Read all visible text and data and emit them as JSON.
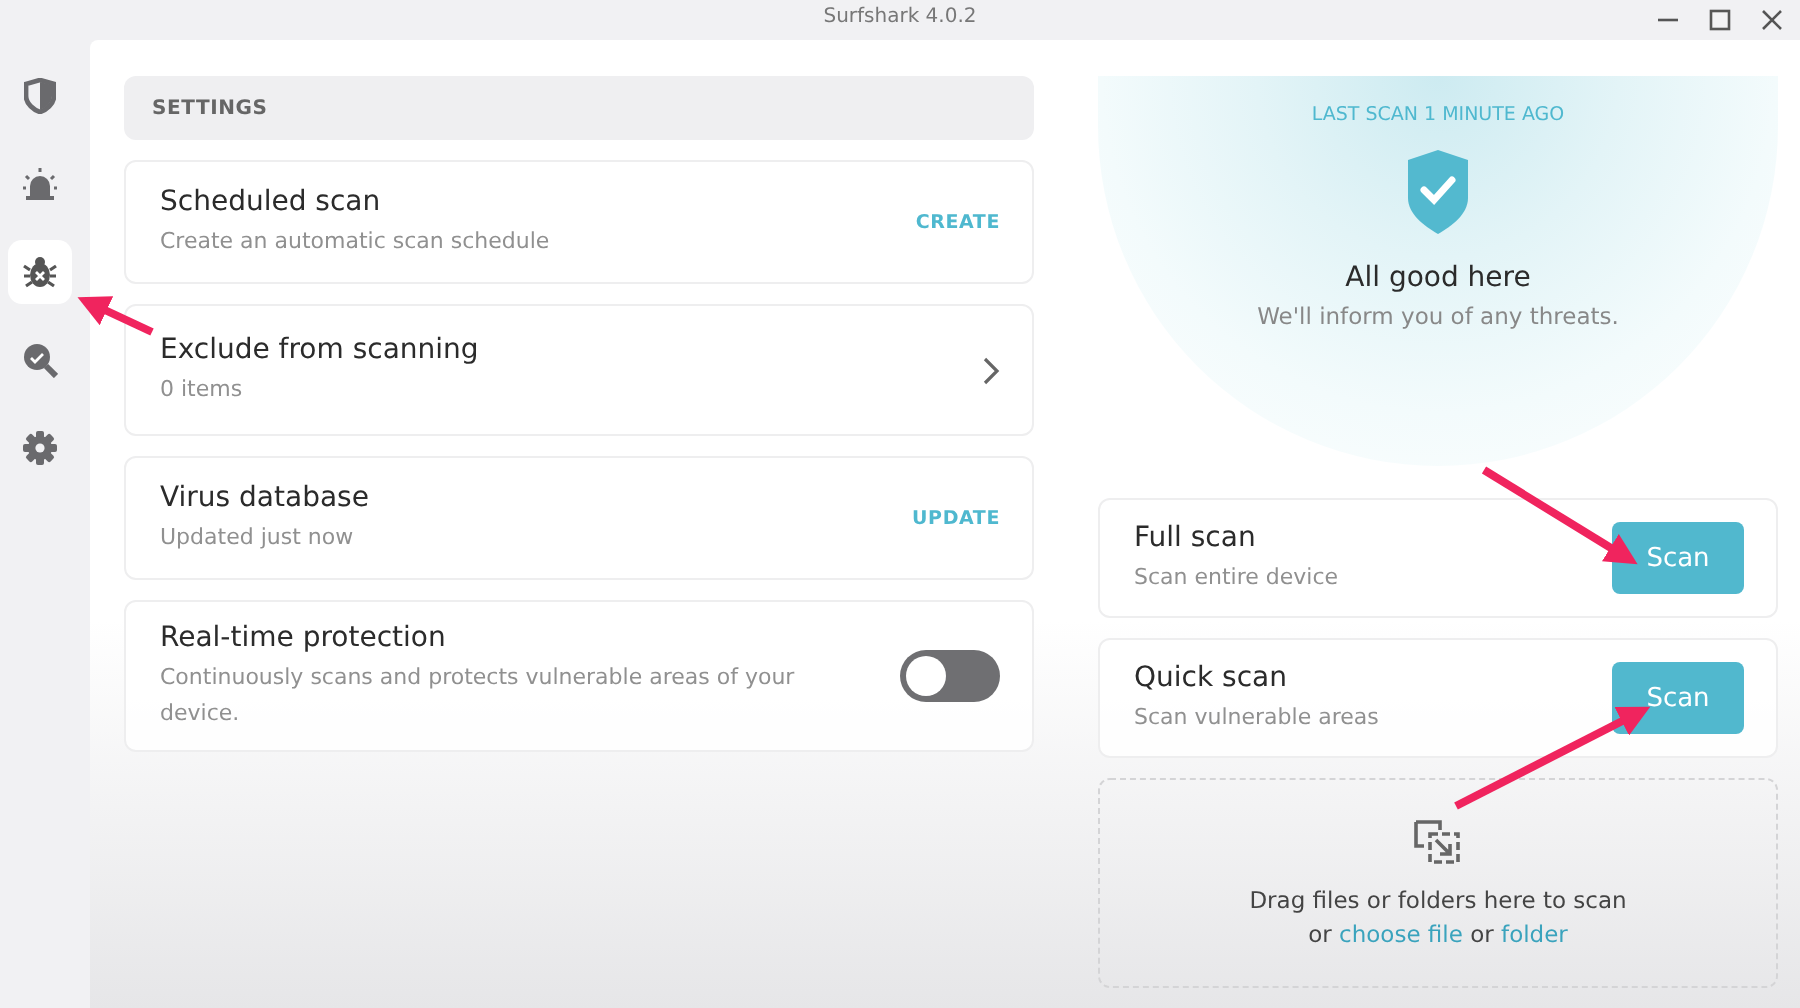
{
  "window": {
    "title": "Surfshark 4.0.2"
  },
  "sidebar": {
    "items": [
      {
        "kind": "shield",
        "selected": false
      },
      {
        "kind": "alarm",
        "selected": false
      },
      {
        "kind": "bug",
        "selected": true
      },
      {
        "kind": "search",
        "selected": false
      },
      {
        "kind": "gear",
        "selected": false
      }
    ]
  },
  "settings": {
    "header": "SETTINGS",
    "rows": [
      {
        "kind": "action",
        "title": "Scheduled scan",
        "subtitle": "Create an automatic scan schedule",
        "action": "CREATE"
      },
      {
        "kind": "chevron",
        "title": "Exclude from scanning",
        "subtitle": "0 items"
      },
      {
        "kind": "action",
        "title": "Virus database",
        "subtitle": "Updated just now",
        "action": "UPDATE"
      },
      {
        "kind": "toggle",
        "title": "Real-time protection",
        "subtitle": "Continuously scans and protects vulnerable areas of your device.",
        "on": false
      }
    ]
  },
  "status": {
    "last_scan": "LAST SCAN 1 MINUTE AGO",
    "title": "All good here",
    "subtitle": "We'll inform you of any threats."
  },
  "scans": [
    {
      "title": "Full scan",
      "subtitle": "Scan entire device",
      "button": "Scan"
    },
    {
      "title": "Quick scan",
      "subtitle": "Scan vulnerable areas",
      "button": "Scan"
    }
  ],
  "drop_zone": {
    "text": "Drag files or folders here to scan",
    "parts": [
      {
        "kind": "text",
        "text": "or"
      },
      {
        "kind": "link",
        "text": "choose file"
      },
      {
        "kind": "text",
        "text": "or"
      },
      {
        "kind": "link",
        "text": "folder"
      }
    ]
  }
}
